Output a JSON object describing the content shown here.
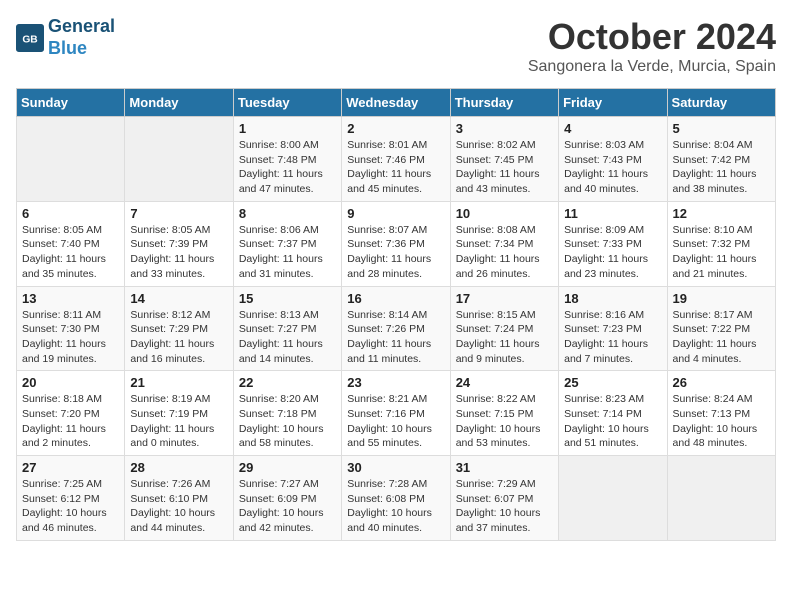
{
  "header": {
    "logo_line1": "General",
    "logo_line2": "Blue",
    "month": "October 2024",
    "location": "Sangonera la Verde, Murcia, Spain"
  },
  "weekdays": [
    "Sunday",
    "Monday",
    "Tuesday",
    "Wednesday",
    "Thursday",
    "Friday",
    "Saturday"
  ],
  "weeks": [
    [
      {
        "day": "",
        "sunrise": "",
        "sunset": "",
        "daylight": ""
      },
      {
        "day": "",
        "sunrise": "",
        "sunset": "",
        "daylight": ""
      },
      {
        "day": "1",
        "sunrise": "Sunrise: 8:00 AM",
        "sunset": "Sunset: 7:48 PM",
        "daylight": "Daylight: 11 hours and 47 minutes."
      },
      {
        "day": "2",
        "sunrise": "Sunrise: 8:01 AM",
        "sunset": "Sunset: 7:46 PM",
        "daylight": "Daylight: 11 hours and 45 minutes."
      },
      {
        "day": "3",
        "sunrise": "Sunrise: 8:02 AM",
        "sunset": "Sunset: 7:45 PM",
        "daylight": "Daylight: 11 hours and 43 minutes."
      },
      {
        "day": "4",
        "sunrise": "Sunrise: 8:03 AM",
        "sunset": "Sunset: 7:43 PM",
        "daylight": "Daylight: 11 hours and 40 minutes."
      },
      {
        "day": "5",
        "sunrise": "Sunrise: 8:04 AM",
        "sunset": "Sunset: 7:42 PM",
        "daylight": "Daylight: 11 hours and 38 minutes."
      }
    ],
    [
      {
        "day": "6",
        "sunrise": "Sunrise: 8:05 AM",
        "sunset": "Sunset: 7:40 PM",
        "daylight": "Daylight: 11 hours and 35 minutes."
      },
      {
        "day": "7",
        "sunrise": "Sunrise: 8:05 AM",
        "sunset": "Sunset: 7:39 PM",
        "daylight": "Daylight: 11 hours and 33 minutes."
      },
      {
        "day": "8",
        "sunrise": "Sunrise: 8:06 AM",
        "sunset": "Sunset: 7:37 PM",
        "daylight": "Daylight: 11 hours and 31 minutes."
      },
      {
        "day": "9",
        "sunrise": "Sunrise: 8:07 AM",
        "sunset": "Sunset: 7:36 PM",
        "daylight": "Daylight: 11 hours and 28 minutes."
      },
      {
        "day": "10",
        "sunrise": "Sunrise: 8:08 AM",
        "sunset": "Sunset: 7:34 PM",
        "daylight": "Daylight: 11 hours and 26 minutes."
      },
      {
        "day": "11",
        "sunrise": "Sunrise: 8:09 AM",
        "sunset": "Sunset: 7:33 PM",
        "daylight": "Daylight: 11 hours and 23 minutes."
      },
      {
        "day": "12",
        "sunrise": "Sunrise: 8:10 AM",
        "sunset": "Sunset: 7:32 PM",
        "daylight": "Daylight: 11 hours and 21 minutes."
      }
    ],
    [
      {
        "day": "13",
        "sunrise": "Sunrise: 8:11 AM",
        "sunset": "Sunset: 7:30 PM",
        "daylight": "Daylight: 11 hours and 19 minutes."
      },
      {
        "day": "14",
        "sunrise": "Sunrise: 8:12 AM",
        "sunset": "Sunset: 7:29 PM",
        "daylight": "Daylight: 11 hours and 16 minutes."
      },
      {
        "day": "15",
        "sunrise": "Sunrise: 8:13 AM",
        "sunset": "Sunset: 7:27 PM",
        "daylight": "Daylight: 11 hours and 14 minutes."
      },
      {
        "day": "16",
        "sunrise": "Sunrise: 8:14 AM",
        "sunset": "Sunset: 7:26 PM",
        "daylight": "Daylight: 11 hours and 11 minutes."
      },
      {
        "day": "17",
        "sunrise": "Sunrise: 8:15 AM",
        "sunset": "Sunset: 7:24 PM",
        "daylight": "Daylight: 11 hours and 9 minutes."
      },
      {
        "day": "18",
        "sunrise": "Sunrise: 8:16 AM",
        "sunset": "Sunset: 7:23 PM",
        "daylight": "Daylight: 11 hours and 7 minutes."
      },
      {
        "day": "19",
        "sunrise": "Sunrise: 8:17 AM",
        "sunset": "Sunset: 7:22 PM",
        "daylight": "Daylight: 11 hours and 4 minutes."
      }
    ],
    [
      {
        "day": "20",
        "sunrise": "Sunrise: 8:18 AM",
        "sunset": "Sunset: 7:20 PM",
        "daylight": "Daylight: 11 hours and 2 minutes."
      },
      {
        "day": "21",
        "sunrise": "Sunrise: 8:19 AM",
        "sunset": "Sunset: 7:19 PM",
        "daylight": "Daylight: 11 hours and 0 minutes."
      },
      {
        "day": "22",
        "sunrise": "Sunrise: 8:20 AM",
        "sunset": "Sunset: 7:18 PM",
        "daylight": "Daylight: 10 hours and 58 minutes."
      },
      {
        "day": "23",
        "sunrise": "Sunrise: 8:21 AM",
        "sunset": "Sunset: 7:16 PM",
        "daylight": "Daylight: 10 hours and 55 minutes."
      },
      {
        "day": "24",
        "sunrise": "Sunrise: 8:22 AM",
        "sunset": "Sunset: 7:15 PM",
        "daylight": "Daylight: 10 hours and 53 minutes."
      },
      {
        "day": "25",
        "sunrise": "Sunrise: 8:23 AM",
        "sunset": "Sunset: 7:14 PM",
        "daylight": "Daylight: 10 hours and 51 minutes."
      },
      {
        "day": "26",
        "sunrise": "Sunrise: 8:24 AM",
        "sunset": "Sunset: 7:13 PM",
        "daylight": "Daylight: 10 hours and 48 minutes."
      }
    ],
    [
      {
        "day": "27",
        "sunrise": "Sunrise: 7:25 AM",
        "sunset": "Sunset: 6:12 PM",
        "daylight": "Daylight: 10 hours and 46 minutes."
      },
      {
        "day": "28",
        "sunrise": "Sunrise: 7:26 AM",
        "sunset": "Sunset: 6:10 PM",
        "daylight": "Daylight: 10 hours and 44 minutes."
      },
      {
        "day": "29",
        "sunrise": "Sunrise: 7:27 AM",
        "sunset": "Sunset: 6:09 PM",
        "daylight": "Daylight: 10 hours and 42 minutes."
      },
      {
        "day": "30",
        "sunrise": "Sunrise: 7:28 AM",
        "sunset": "Sunset: 6:08 PM",
        "daylight": "Daylight: 10 hours and 40 minutes."
      },
      {
        "day": "31",
        "sunrise": "Sunrise: 7:29 AM",
        "sunset": "Sunset: 6:07 PM",
        "daylight": "Daylight: 10 hours and 37 minutes."
      },
      {
        "day": "",
        "sunrise": "",
        "sunset": "",
        "daylight": ""
      },
      {
        "day": "",
        "sunrise": "",
        "sunset": "",
        "daylight": ""
      }
    ]
  ]
}
